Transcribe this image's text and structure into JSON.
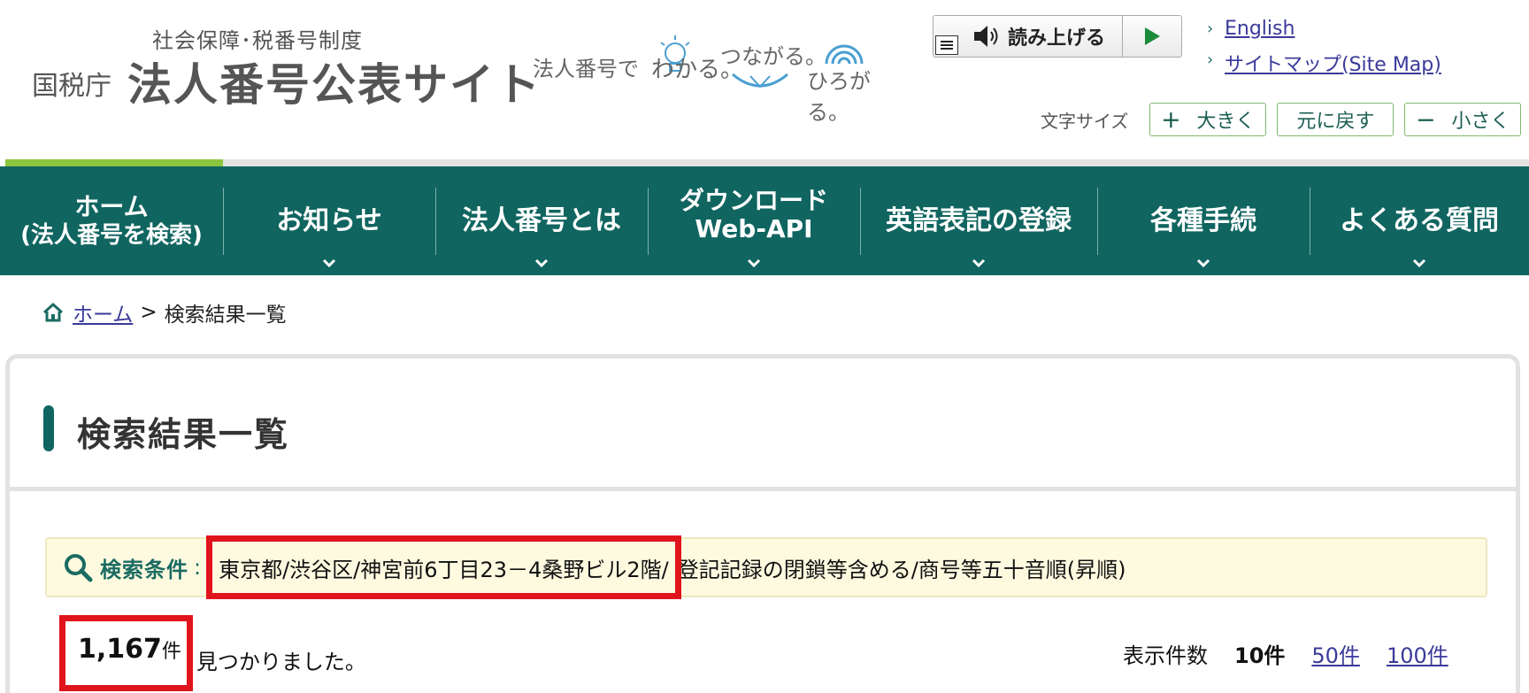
{
  "header": {
    "logo_subtitle": "社会保障･税番号制度",
    "logo_agency": "国税庁",
    "logo_title": "法人番号公表サイト",
    "tagline": {
      "part1": "法人番号で",
      "part2": "わかる。",
      "part3": "つながる。",
      "part4": "ひろがる。"
    },
    "read_aloud_label": "読み上げる",
    "links": [
      "English",
      "サイトマップ(Site Map)"
    ],
    "font_size": {
      "label": "文字サイズ",
      "larger": "大きく",
      "reset": "元に戻す",
      "smaller": "小さく"
    }
  },
  "nav": {
    "home_line1": "ホーム",
    "home_line2": "(法人番号を検索)",
    "news": "お知らせ",
    "about": "法人番号とは",
    "download_line1": "ダウンロード",
    "download_line2": "Web-API",
    "english": "英語表記の登録",
    "procedures": "各種手続",
    "faq": "よくある質問"
  },
  "breadcrumb": {
    "home": "ホーム",
    "separator": ">",
    "current": "検索結果一覧"
  },
  "page": {
    "title": "検索結果一覧",
    "condition_label": "検索条件",
    "condition_colon": ":",
    "condition_highlighted": "東京都/渋谷区/神宮前6丁目23－4桑野ビル2階/",
    "condition_rest": "登記記録の閉鎖等含める/商号等五十音順(昇順)",
    "result_count": "1,167",
    "result_unit": "件",
    "result_found": "見つかりました。",
    "per_page_label": "表示件数",
    "per_page_current": "10件",
    "per_page_option_50": "50件",
    "per_page_option_100": "100件"
  },
  "colors": {
    "nav_bg": "#106560",
    "accent_green": "#8cc63f",
    "highlight_red": "#e0141c",
    "condition_bg": "#fdfae0"
  }
}
